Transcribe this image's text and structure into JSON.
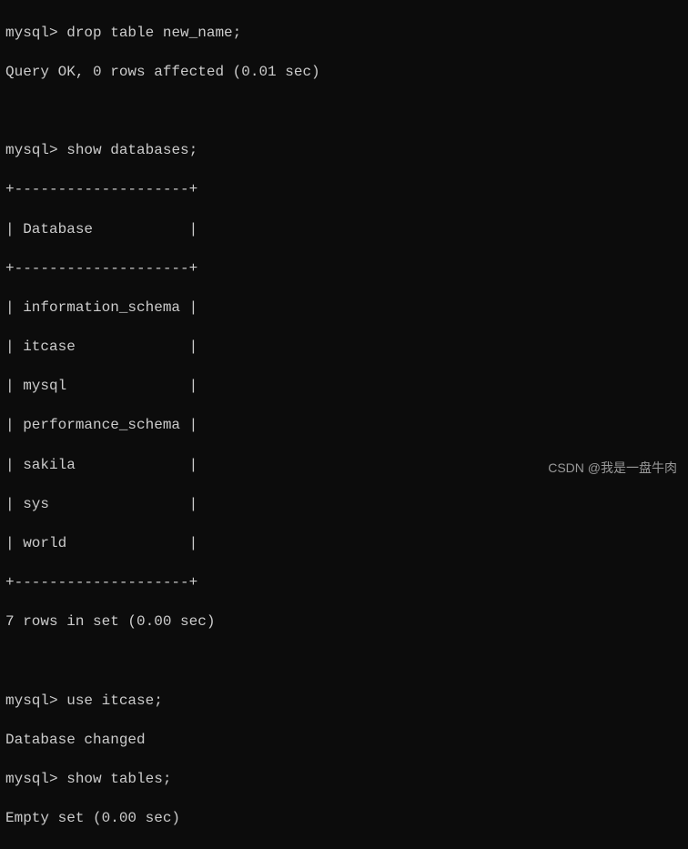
{
  "prompt": "mysql>",
  "cmd1": "drop table new_name;",
  "result1": "Query OK, 0 rows affected (0.01 sec)",
  "cmd2": "show databases;",
  "table_border": "+--------------------+",
  "table_header_line": "| Database           |",
  "databases": [
    "| information_schema |",
    "| itcase             |",
    "| mysql              |",
    "| performance_schema |",
    "| sakila             |",
    "| sys                |",
    "| world              |"
  ],
  "rows_result": "7 rows in set (0.00 sec)",
  "cmd3": "use itcase;",
  "result3": "Database changed",
  "cmd4": "show tables;",
  "result4": "Empty set (0.00 sec)",
  "watermark": "CSDN @我是一盘牛肉"
}
